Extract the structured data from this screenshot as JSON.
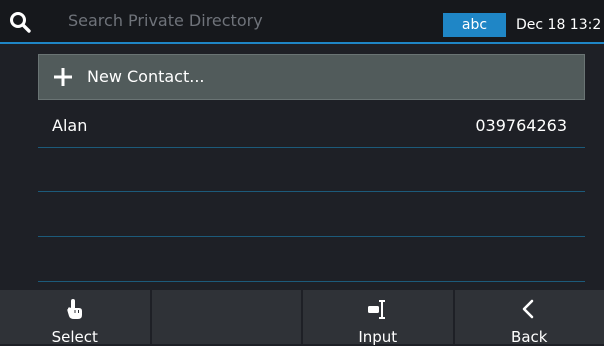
{
  "header": {
    "search_placeholder": "Search Private Directory",
    "mode_badge": "abc",
    "clock": "Dec 18 13:2",
    "icon": "search-icon"
  },
  "new_contact": {
    "label": "New Contact...",
    "icon": "plus-icon"
  },
  "contacts": [
    {
      "name": "Alan",
      "number": "039764263"
    }
  ],
  "softkeys": [
    {
      "label": "Select",
      "icon": "hand-pointer-icon"
    },
    {
      "label": "",
      "icon": ""
    },
    {
      "label": "Input",
      "icon": "text-cursor-icon"
    },
    {
      "label": "Back",
      "icon": "chevron-left-icon"
    }
  ],
  "colors": {
    "accent": "#1f86c6",
    "background": "#1e2026",
    "highlight_row": "#515b5b",
    "softkey_bar": "#2f3237"
  }
}
